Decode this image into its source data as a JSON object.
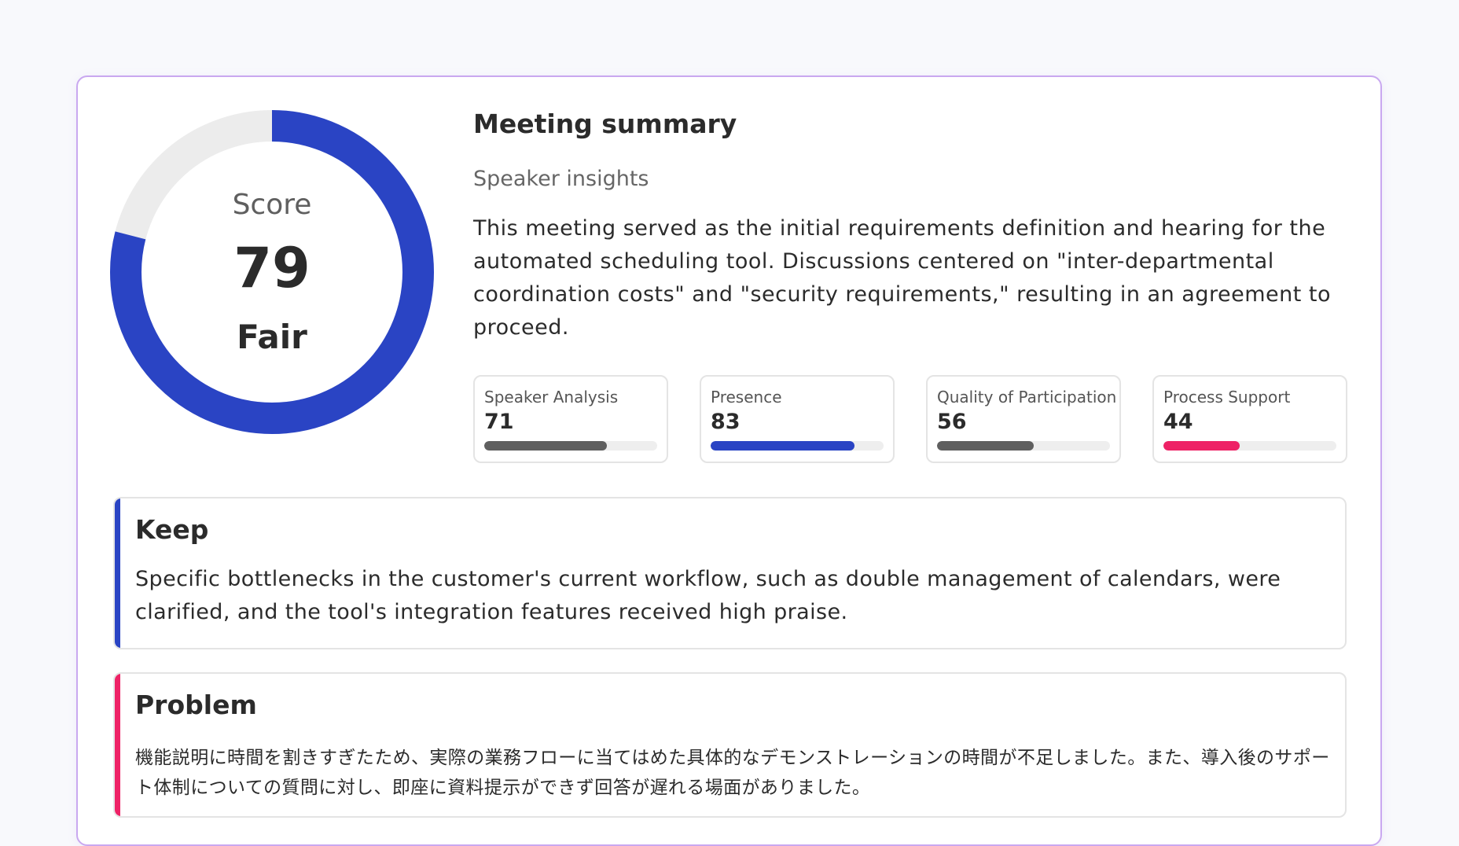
{
  "score": {
    "label": "Score",
    "value": 79,
    "max": 100,
    "rating": "Fair",
    "color": "#2a44c4",
    "track_color": "#ececec"
  },
  "summary": {
    "title": "Meeting summary",
    "subtitle": "Speaker insights",
    "text": "This meeting served as the initial requirements definition and hearing for the automated scheduling tool. Discussions centered on \"inter-departmental coordination costs\" and \"security requirements,\" resulting in an agreement to proceed."
  },
  "metrics": [
    {
      "label": "Speaker Analysis",
      "value": 71,
      "color": "#5f5f5f"
    },
    {
      "label": "Presence",
      "value": 83,
      "color": "#2a44c4"
    },
    {
      "label": "Quality of Participation",
      "value": 56,
      "color": "#5f5f5f"
    },
    {
      "label": "Process Support",
      "value": 44,
      "color": "#ee2266"
    }
  ],
  "keep": {
    "title": "Keep",
    "text": "Specific bottlenecks in the customer's current workflow, such as double management of calendars, were clarified, and the tool's integration features received high praise.",
    "accent": "#2a44c4"
  },
  "problem": {
    "title": "Problem",
    "text": "機能説明に時間を割きすぎたため、実際の業務フローに当てはめた具体的なデモンストレーションの時間が不足しました。また、導入後のサポート体制についての質問に対し、即座に資料提示ができず回答が遅れる場面がありました。",
    "accent": "#ee2266"
  }
}
